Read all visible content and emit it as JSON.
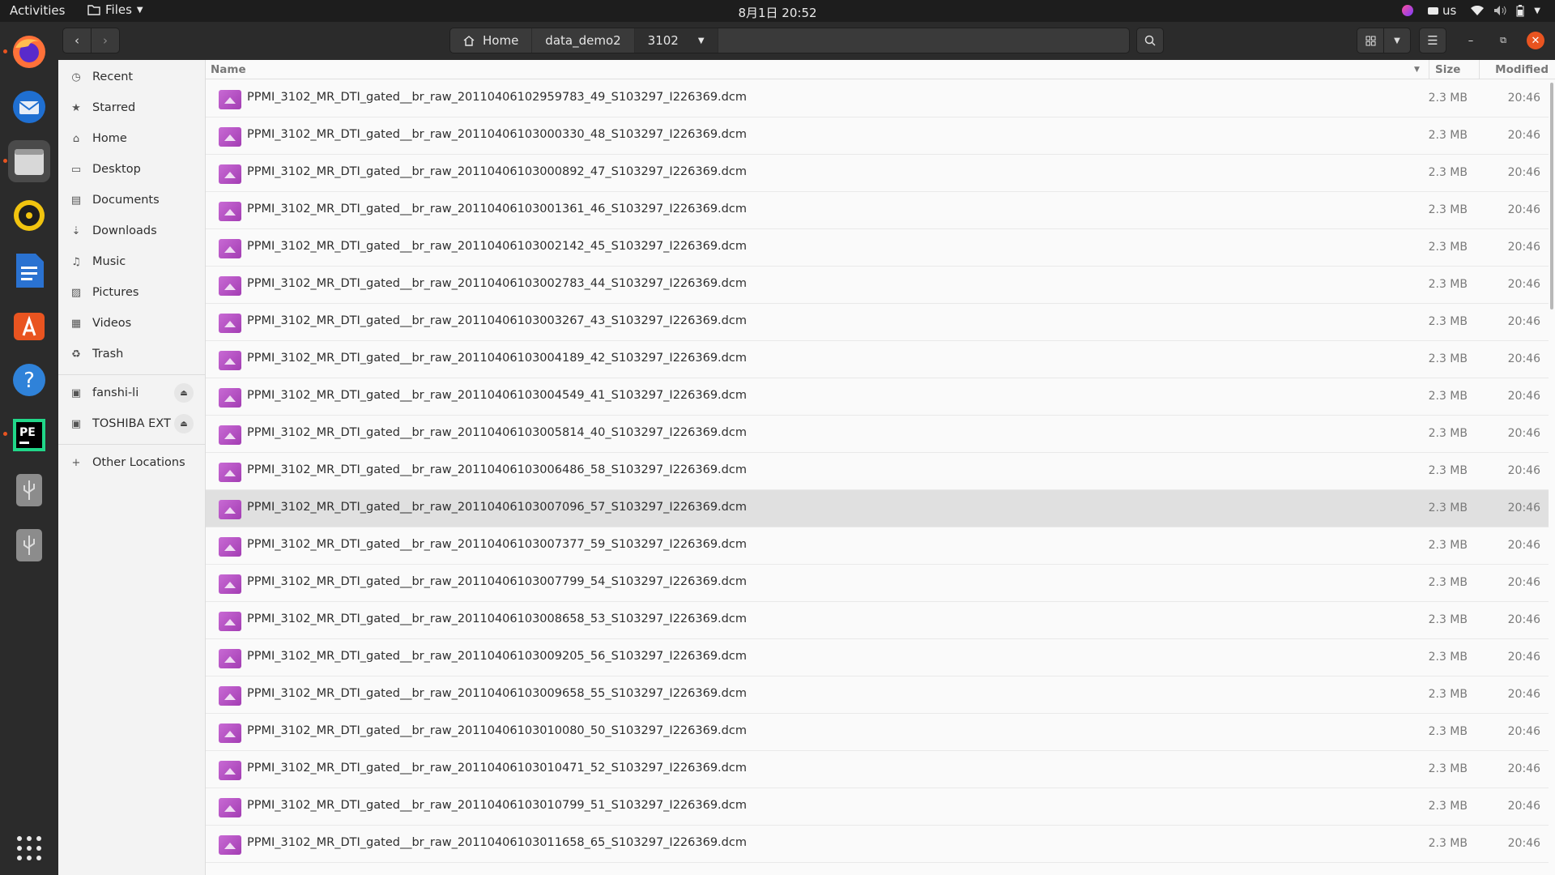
{
  "topbar": {
    "activities": "Activities",
    "app_menu": "Files",
    "clock": "8月1日  20:52",
    "keyboard_layout": "us"
  },
  "dock": {
    "items": [
      "firefox-icon",
      "thunderbird-icon",
      "files-icon",
      "rhythmbox-icon",
      "writer-icon",
      "app-center-icon",
      "help-icon",
      "pycharm-icon",
      "usb-drive-icon",
      "usb-drive-icon"
    ]
  },
  "header": {
    "breadcrumbs": [
      "Home",
      "data_demo2",
      "3102"
    ]
  },
  "sidebar": {
    "items": [
      {
        "label": "Recent",
        "icon": "clock-icon"
      },
      {
        "label": "Starred",
        "icon": "star-icon"
      },
      {
        "label": "Home",
        "icon": "home-icon"
      },
      {
        "label": "Desktop",
        "icon": "desktop-icon"
      },
      {
        "label": "Documents",
        "icon": "document-icon"
      },
      {
        "label": "Downloads",
        "icon": "download-icon"
      },
      {
        "label": "Music",
        "icon": "music-icon"
      },
      {
        "label": "Pictures",
        "icon": "picture-icon"
      },
      {
        "label": "Videos",
        "icon": "video-icon"
      },
      {
        "label": "Trash",
        "icon": "trash-icon"
      }
    ],
    "devices": [
      {
        "label": "fanshi-li"
      },
      {
        "label": "TOSHIBA EXT"
      }
    ],
    "other": "Other Locations"
  },
  "list": {
    "columns": {
      "name": "Name",
      "size": "Size",
      "modified": "Modified"
    },
    "selected_index": 11,
    "files": [
      {
        "name": "PPMI_3102_MR_DTI_gated__br_raw_20110406102959783_49_S103297_I226369.dcm",
        "size": "2.3 MB",
        "modified": "20:46"
      },
      {
        "name": "PPMI_3102_MR_DTI_gated__br_raw_20110406103000330_48_S103297_I226369.dcm",
        "size": "2.3 MB",
        "modified": "20:46"
      },
      {
        "name": "PPMI_3102_MR_DTI_gated__br_raw_20110406103000892_47_S103297_I226369.dcm",
        "size": "2.3 MB",
        "modified": "20:46"
      },
      {
        "name": "PPMI_3102_MR_DTI_gated__br_raw_20110406103001361_46_S103297_I226369.dcm",
        "size": "2.3 MB",
        "modified": "20:46"
      },
      {
        "name": "PPMI_3102_MR_DTI_gated__br_raw_20110406103002142_45_S103297_I226369.dcm",
        "size": "2.3 MB",
        "modified": "20:46"
      },
      {
        "name": "PPMI_3102_MR_DTI_gated__br_raw_20110406103002783_44_S103297_I226369.dcm",
        "size": "2.3 MB",
        "modified": "20:46"
      },
      {
        "name": "PPMI_3102_MR_DTI_gated__br_raw_20110406103003267_43_S103297_I226369.dcm",
        "size": "2.3 MB",
        "modified": "20:46"
      },
      {
        "name": "PPMI_3102_MR_DTI_gated__br_raw_20110406103004189_42_S103297_I226369.dcm",
        "size": "2.3 MB",
        "modified": "20:46"
      },
      {
        "name": "PPMI_3102_MR_DTI_gated__br_raw_20110406103004549_41_S103297_I226369.dcm",
        "size": "2.3 MB",
        "modified": "20:46"
      },
      {
        "name": "PPMI_3102_MR_DTI_gated__br_raw_20110406103005814_40_S103297_I226369.dcm",
        "size": "2.3 MB",
        "modified": "20:46"
      },
      {
        "name": "PPMI_3102_MR_DTI_gated__br_raw_20110406103006486_58_S103297_I226369.dcm",
        "size": "2.3 MB",
        "modified": "20:46"
      },
      {
        "name": "PPMI_3102_MR_DTI_gated__br_raw_20110406103007096_57_S103297_I226369.dcm",
        "size": "2.3 MB",
        "modified": "20:46"
      },
      {
        "name": "PPMI_3102_MR_DTI_gated__br_raw_20110406103007377_59_S103297_I226369.dcm",
        "size": "2.3 MB",
        "modified": "20:46"
      },
      {
        "name": "PPMI_3102_MR_DTI_gated__br_raw_20110406103007799_54_S103297_I226369.dcm",
        "size": "2.3 MB",
        "modified": "20:46"
      },
      {
        "name": "PPMI_3102_MR_DTI_gated__br_raw_20110406103008658_53_S103297_I226369.dcm",
        "size": "2.3 MB",
        "modified": "20:46"
      },
      {
        "name": "PPMI_3102_MR_DTI_gated__br_raw_20110406103009205_56_S103297_I226369.dcm",
        "size": "2.3 MB",
        "modified": "20:46"
      },
      {
        "name": "PPMI_3102_MR_DTI_gated__br_raw_20110406103009658_55_S103297_I226369.dcm",
        "size": "2.3 MB",
        "modified": "20:46"
      },
      {
        "name": "PPMI_3102_MR_DTI_gated__br_raw_20110406103010080_50_S103297_I226369.dcm",
        "size": "2.3 MB",
        "modified": "20:46"
      },
      {
        "name": "PPMI_3102_MR_DTI_gated__br_raw_20110406103010471_52_S103297_I226369.dcm",
        "size": "2.3 MB",
        "modified": "20:46"
      },
      {
        "name": "PPMI_3102_MR_DTI_gated__br_raw_20110406103010799_51_S103297_I226369.dcm",
        "size": "2.3 MB",
        "modified": "20:46"
      },
      {
        "name": "PPMI_3102_MR_DTI_gated__br_raw_20110406103011658_65_S103297_I226369.dcm",
        "size": "2.3 MB",
        "modified": "20:46"
      }
    ]
  },
  "colors": {
    "accent": "#e95420",
    "file_icon": "#b84ac6",
    "selection": "#e0e0e0"
  }
}
